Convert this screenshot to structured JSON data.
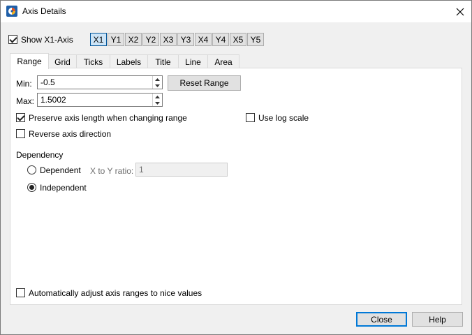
{
  "window": {
    "title": "Axis Details",
    "icon": "tecplot-app-icon"
  },
  "show_axis": {
    "label": "Show X1-Axis",
    "checked": true
  },
  "axis_buttons": [
    "X1",
    "Y1",
    "X2",
    "Y2",
    "X3",
    "Y3",
    "X4",
    "Y4",
    "X5",
    "Y5"
  ],
  "selected_axis": "X1",
  "tabs": [
    "Range",
    "Grid",
    "Ticks",
    "Labels",
    "Title",
    "Line",
    "Area"
  ],
  "active_tab": "Range",
  "range": {
    "min_label": "Min:",
    "min_value": "-0.5",
    "max_label": "Max:",
    "max_value": "1.5002",
    "reset_button": "Reset Range"
  },
  "options": {
    "preserve_length": {
      "label": "Preserve axis length when changing range",
      "checked": true
    },
    "use_log": {
      "label": "Use log scale",
      "checked": false
    },
    "reverse_direction": {
      "label": "Reverse axis direction",
      "checked": false
    },
    "auto_adjust": {
      "label": "Automatically adjust axis ranges to nice values",
      "checked": false
    }
  },
  "dependency": {
    "heading": "Dependency",
    "dependent_label": "Dependent",
    "independent_label": "Independent",
    "selected": "Independent",
    "ratio_label": "X to Y ratio:",
    "ratio_value": "1"
  },
  "footer": {
    "close_button": "Close",
    "help_button": "Help"
  }
}
